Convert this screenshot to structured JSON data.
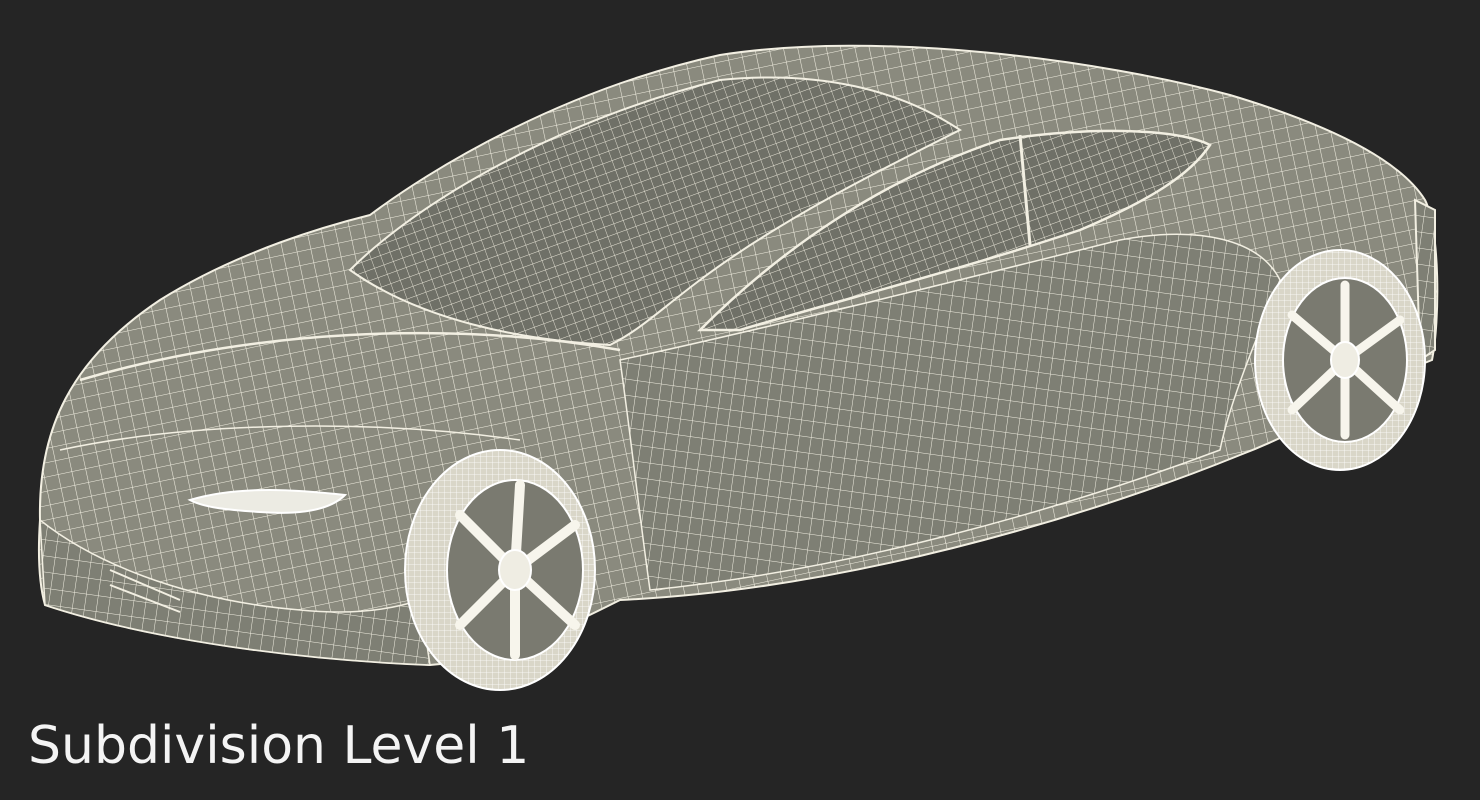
{
  "caption": "Subdivision Level 1",
  "colors": {
    "background": "#252525",
    "body_fill": "#8c8c80",
    "wire": "#f2efe2",
    "caption": "#f4f4f4"
  }
}
